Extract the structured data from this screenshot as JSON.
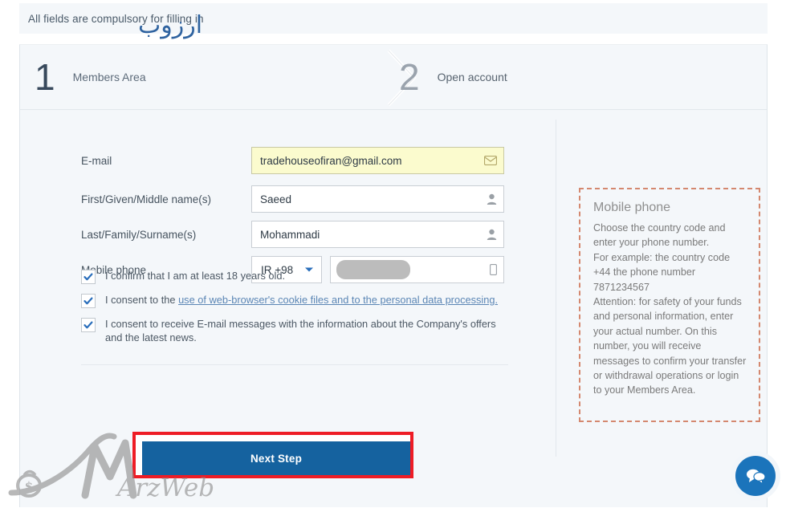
{
  "notice": {
    "text": "All fields are compulsory for filling in"
  },
  "steps": [
    {
      "number": "1",
      "label": "Members Area",
      "state": "active"
    },
    {
      "number": "2",
      "label": "Open account",
      "state": "inactive"
    }
  ],
  "form": {
    "fields": [
      {
        "label": "E-mail",
        "value": "tradehouseofiran@gmail.com",
        "placeholder": "",
        "icon": "envelope-icon",
        "highlight": true
      },
      {
        "label": "First/Given/Middle name(s)",
        "value": "Saeed",
        "placeholder": "",
        "icon": "user-icon",
        "highlight": false
      },
      {
        "label": "Last/Family/Surname(s)",
        "value": "Mohammadi",
        "placeholder": "",
        "icon": "user-icon",
        "highlight": false
      }
    ],
    "phone": {
      "label": "Mobile phone",
      "country_code": "IR +98",
      "number": "",
      "placeholder": "",
      "icon": "mobile-phone-icon",
      "redacted": true
    },
    "checkboxes": [
      {
        "checked": true,
        "text": "I confirm that I am at least 18 years old.",
        "link_text": "",
        "text_after": ""
      },
      {
        "checked": true,
        "text": "I consent to the ",
        "link_text": "use of web-browser's cookie files and to the personal data processing.",
        "text_after": ""
      },
      {
        "checked": true,
        "text": "I consent to receive E-mail messages with the information about the Company's offers and the latest news.",
        "link_text": "",
        "text_after": ""
      }
    ],
    "submit_label": "Next Step"
  },
  "info_box": {
    "title": "Mobile phone",
    "body": "Choose the country code and enter your phone number.\nFor example: the country code +44 the phone number 7871234567\nAttention: for safety of your funds and personal information, enter your actual number. On this number, you will receive messages to confirm your transfer or withdrawal operations or login to your Members Area."
  },
  "watermark": {
    "latin_text": "ArzWeb",
    "persian_text": "ارزوب"
  },
  "chat": {
    "icon": "chat-bubbles-icon"
  },
  "colors": {
    "accent_blue": "#15629f",
    "highlight_red": "#ee1c25",
    "panel_bg": "#f4f7fa",
    "info_border": "#d4886f",
    "highlight_yellow": "#fbfbce"
  }
}
